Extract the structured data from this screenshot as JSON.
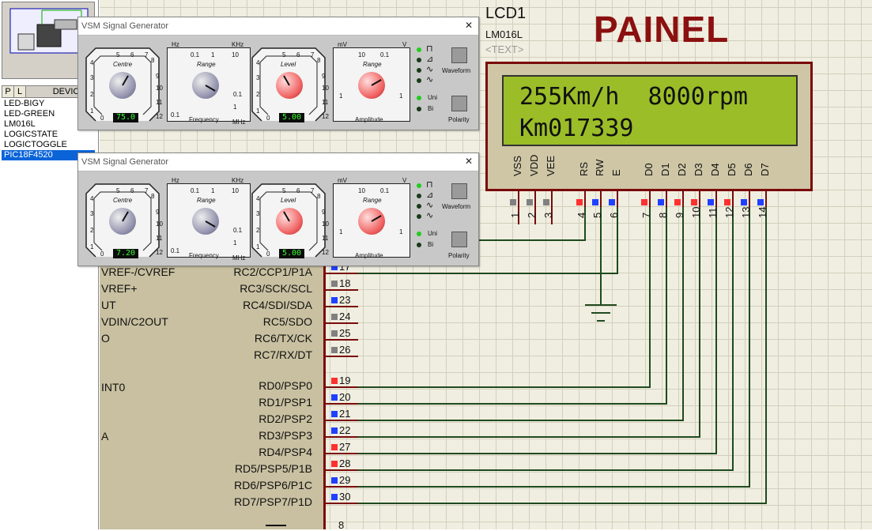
{
  "sidebar": {
    "tab_p": "P",
    "tab_l": "L",
    "tab_devices": "DEVICES",
    "devices": [
      "LED-BIGY",
      "LED-GREEN",
      "LM016L",
      "LOGICSTATE",
      "LOGICTOGGLE",
      "PIC18F4520"
    ],
    "selected_device": "PIC18F4520"
  },
  "lcd": {
    "title": "LCD1",
    "part": "LM016L",
    "text_placeholder": "<TEXT>",
    "line1": "255Km/h  8000rpm",
    "line2": "Km017339",
    "pins": [
      {
        "num": "1",
        "name": "VSS",
        "state": "grey"
      },
      {
        "num": "2",
        "name": "VDD",
        "state": "grey"
      },
      {
        "num": "3",
        "name": "VEE",
        "state": "grey"
      },
      {
        "num": "4",
        "name": "RS",
        "state": "red"
      },
      {
        "num": "5",
        "name": "RW",
        "state": "blue"
      },
      {
        "num": "6",
        "name": "E",
        "state": "blue"
      },
      {
        "num": "7",
        "name": "D0",
        "state": "red"
      },
      {
        "num": "8",
        "name": "D1",
        "state": "blue"
      },
      {
        "num": "9",
        "name": "D2",
        "state": "red"
      },
      {
        "num": "10",
        "name": "D3",
        "state": "red"
      },
      {
        "num": "11",
        "name": "D4",
        "state": "blue"
      },
      {
        "num": "12",
        "name": "D5",
        "state": "red"
      },
      {
        "num": "13",
        "name": "D6",
        "state": "blue"
      },
      {
        "num": "14",
        "name": "D7",
        "state": "blue"
      }
    ]
  },
  "painel_label": "PAINEL",
  "mcu": {
    "left_labels": [
      "VREF-/CVREF",
      "VREF+",
      "UT",
      "VDIN/C2OUT",
      "O",
      "INT0",
      "A"
    ],
    "right_pins": [
      {
        "label": "RC2/CCP1/P1A",
        "num": "17",
        "state": "blue"
      },
      {
        "label": "RC3/SCK/SCL",
        "num": "18",
        "state": "grey"
      },
      {
        "label": "RC4/SDI/SDA",
        "num": "23",
        "state": "blue"
      },
      {
        "label": "RC5/SDO",
        "num": "24",
        "state": "grey"
      },
      {
        "label": "RC6/TX/CK",
        "num": "25",
        "state": "grey"
      },
      {
        "label": "RC7/RX/DT",
        "num": "26",
        "state": "grey"
      },
      {
        "label": "RD0/PSP0",
        "num": "19",
        "state": "red"
      },
      {
        "label": "RD1/PSP1",
        "num": "20",
        "state": "blue"
      },
      {
        "label": "RD2/PSP2",
        "num": "21",
        "state": "blue"
      },
      {
        "label": "RD3/PSP3",
        "num": "22",
        "state": "blue"
      },
      {
        "label": "RD4/PSP4",
        "num": "27",
        "state": "red"
      },
      {
        "label": "RD5/PSP5/P1B",
        "num": "28",
        "state": "red"
      },
      {
        "label": "RD6/PSP6/P1C",
        "num": "29",
        "state": "blue"
      },
      {
        "label": "RD7/PSP7/P1D",
        "num": "30",
        "state": "blue"
      }
    ],
    "bottom_pin": "8"
  },
  "generators": [
    {
      "title": "VSM Signal Generator",
      "centre_label": "Centre",
      "centre_value": "75.0",
      "range_label": "Range",
      "frequency_label": "Frequency",
      "level_label": "Level",
      "level_value": "5.00",
      "amp_range_label": "Range",
      "amplitude_label": "Amplitude",
      "waveform_label": "Waveform",
      "polarity_label": "Polarity",
      "uni_label": "Uni",
      "bi_label": "Bi",
      "hz_label": "Hz",
      "khz_label": "KHz",
      "mhz_label": "MHz",
      "mv_label": "mV",
      "v_label": "V"
    },
    {
      "title": "VSM Signal Generator",
      "centre_label": "Centre",
      "centre_value": "7.20",
      "range_label": "Range",
      "frequency_label": "Frequency",
      "level_label": "Level",
      "level_value": "5.00",
      "amp_range_label": "Range",
      "amplitude_label": "Amplitude",
      "waveform_label": "Waveform",
      "polarity_label": "Polarity",
      "uni_label": "Uni",
      "bi_label": "Bi",
      "hz_label": "Hz",
      "khz_label": "KHz",
      "mhz_label": "MHz",
      "mv_label": "mV",
      "v_label": "V"
    }
  ],
  "dial": {
    "centre_scale": [
      "0",
      "1",
      "2",
      "3",
      "4",
      "5",
      "6",
      "7",
      "8",
      "9",
      "10",
      "11",
      "12"
    ],
    "range_top": [
      "0.1",
      "1",
      "10"
    ],
    "range_left": "0.1",
    "range_right": [
      "0.1",
      "1"
    ],
    "amp_range": [
      "10",
      "0.1",
      "1",
      "1"
    ]
  },
  "colors": {
    "pin_red": "#ff3030",
    "pin_blue": "#2040ff",
    "pin_grey": "#808080",
    "wire": "#1f4a1f",
    "lcd_screen": "#9bbd28",
    "painel": "#8b1010"
  }
}
